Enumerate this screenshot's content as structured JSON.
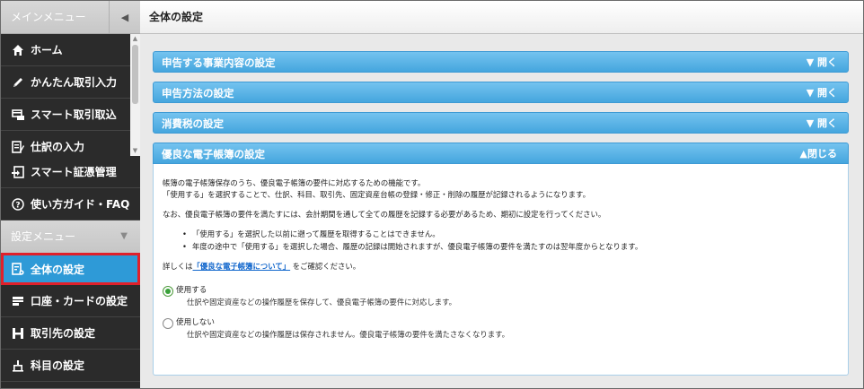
{
  "sidebar": {
    "header_label": "メインメニュー",
    "collapse_glyph": "◀",
    "main_items": [
      {
        "label": "ホーム",
        "icon": "home-icon"
      },
      {
        "label": "かんたん取引入力",
        "icon": "pencil-icon"
      },
      {
        "label": "スマート取引取込",
        "icon": "import-card-icon"
      },
      {
        "label": "仕訳の入力",
        "icon": "journal-icon"
      }
    ],
    "lower_items": [
      {
        "label": "スマート証憑管理",
        "icon": "document-import-icon"
      },
      {
        "label": "使い方ガイド・FAQ",
        "icon": "help-icon"
      }
    ],
    "settings_header": "設定メニュー",
    "settings_items": [
      {
        "label": "全体の設定",
        "icon": "settings-document-icon"
      },
      {
        "label": "口座・カードの設定",
        "icon": "account-card-icon"
      },
      {
        "label": "取引先の設定",
        "icon": "partner-icon"
      },
      {
        "label": "科目の設定",
        "icon": "hierarchy-icon"
      }
    ]
  },
  "page": {
    "title": "全体の設定"
  },
  "accordion": [
    {
      "label": "申告する事業内容の設定",
      "toggle": "▼ 開く"
    },
    {
      "label": "申告方法の設定",
      "toggle": "▼ 開く"
    },
    {
      "label": "消費税の設定",
      "toggle": "▼ 開く"
    },
    {
      "label": "優良な電子帳簿の設定",
      "toggle": "▲閉じる"
    }
  ],
  "panel": {
    "line1": "帳簿の電子帳簿保存のうち、優良電子帳簿の要件に対応するための機能です。",
    "line2": "「使用する」を選択することで、仕訳、科目、取引先、固定資産台帳の登録・修正・削除の履歴が記録されるようになります。",
    "line3": "なお、優良電子帳簿の要件を満たすには、会計期間を通して全ての履歴を記録する必要があるため、期初に設定を行ってください。",
    "bullets": [
      "「使用する」を選択した以前に遡って履歴を取得することはできません。",
      "年度の途中で「使用する」を選択した場合、履歴の記録は開始されますが、優良電子帳簿の要件を満たすのは翌年度からとなります。"
    ],
    "details_prefix": "詳しくは",
    "details_link": "「優良な電子帳簿について」",
    "details_suffix": "をご確認ください。",
    "options": [
      {
        "label": "使用する",
        "desc": "仕訳や固定資産などの操作履歴を保存して、優良電子帳簿の要件に対応します。",
        "checked": true
      },
      {
        "label": "使用しない",
        "desc": "仕訳や固定資産などの操作履歴は保存されません。優良電子帳簿の要件を満たさなくなります。",
        "checked": false
      }
    ]
  },
  "colors": {
    "accent": "#2e9ad7",
    "highlight_border": "#e0202a",
    "accordion": "#45a6de"
  }
}
